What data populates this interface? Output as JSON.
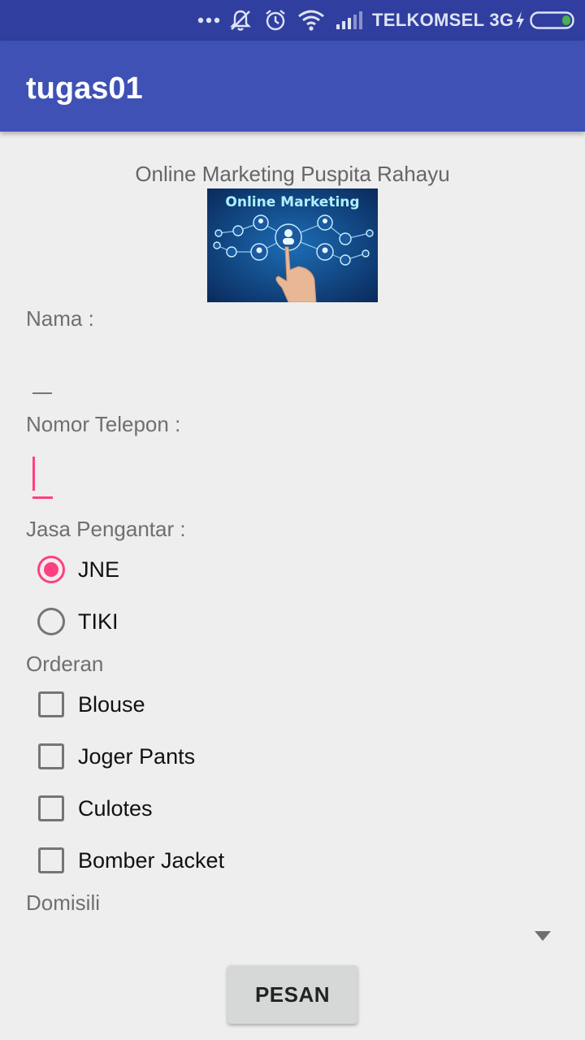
{
  "status_bar": {
    "carrier": "TELKOMSEL 3G",
    "icons": [
      "more-dots-icon",
      "notifications-muted-icon",
      "alarm-icon",
      "wifi-icon",
      "cell-signal-icon",
      "charging-bolt-icon",
      "battery-icon"
    ]
  },
  "app_bar": {
    "title": "tugas01"
  },
  "header": {
    "title": "Online Marketing Puspita Rahayu",
    "banner_text": "Online Marketing"
  },
  "form": {
    "nama_label": "Nama :",
    "nama_value": "",
    "telepon_label": "Nomor Telepon :",
    "telepon_value": "",
    "jasa_label": "Jasa Pengantar :",
    "jasa_options": [
      {
        "label": "JNE",
        "checked": true
      },
      {
        "label": "TIKI",
        "checked": false
      }
    ],
    "orderan_label": "Orderan",
    "orderan_options": [
      {
        "label": "Blouse",
        "checked": false
      },
      {
        "label": "Joger Pants",
        "checked": false
      },
      {
        "label": "Culotes",
        "checked": false
      },
      {
        "label": "Bomber Jacket",
        "checked": false
      }
    ],
    "domisili_label": "Domisili",
    "domisili_value": "",
    "submit_label": "PESAN"
  },
  "colors": {
    "primary": "#3f51b5",
    "primary_dark": "#303f9f",
    "accent": "#ff4081",
    "background": "#eeeeee"
  }
}
